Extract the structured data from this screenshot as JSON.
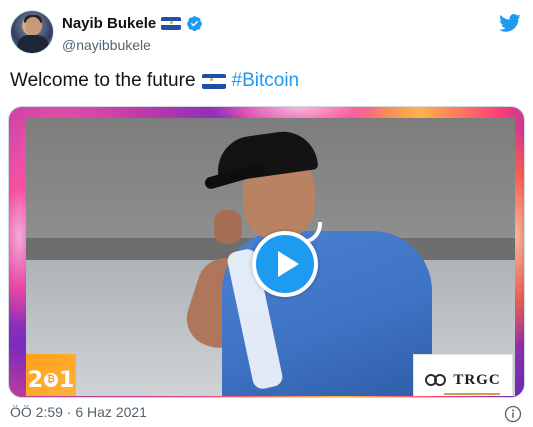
{
  "author": {
    "display_name": "Nayib Bukele",
    "username": "@nayibbukele",
    "flag_icon": "el-salvador-flag-icon",
    "verified_icon": "verified-badge-icon"
  },
  "brand": {
    "icon": "twitter-bird-icon",
    "color": "#1d9bf0"
  },
  "tweet": {
    "text": "Welcome to the future",
    "flag_icon": "el-salvador-flag-icon",
    "hashtag": "#Bitcoin"
  },
  "media": {
    "type": "video",
    "play_icon": "play-icon",
    "overlay_left_logo": "21",
    "overlay_right_logo": "TRGC"
  },
  "meta": {
    "timestamp": "ÖÖ 2:59 · 6 Haz 2021",
    "info_icon": "info-icon"
  },
  "colors": {
    "accent": "#1d9bf0",
    "text": "#0f1419",
    "secondary": "#536471"
  }
}
